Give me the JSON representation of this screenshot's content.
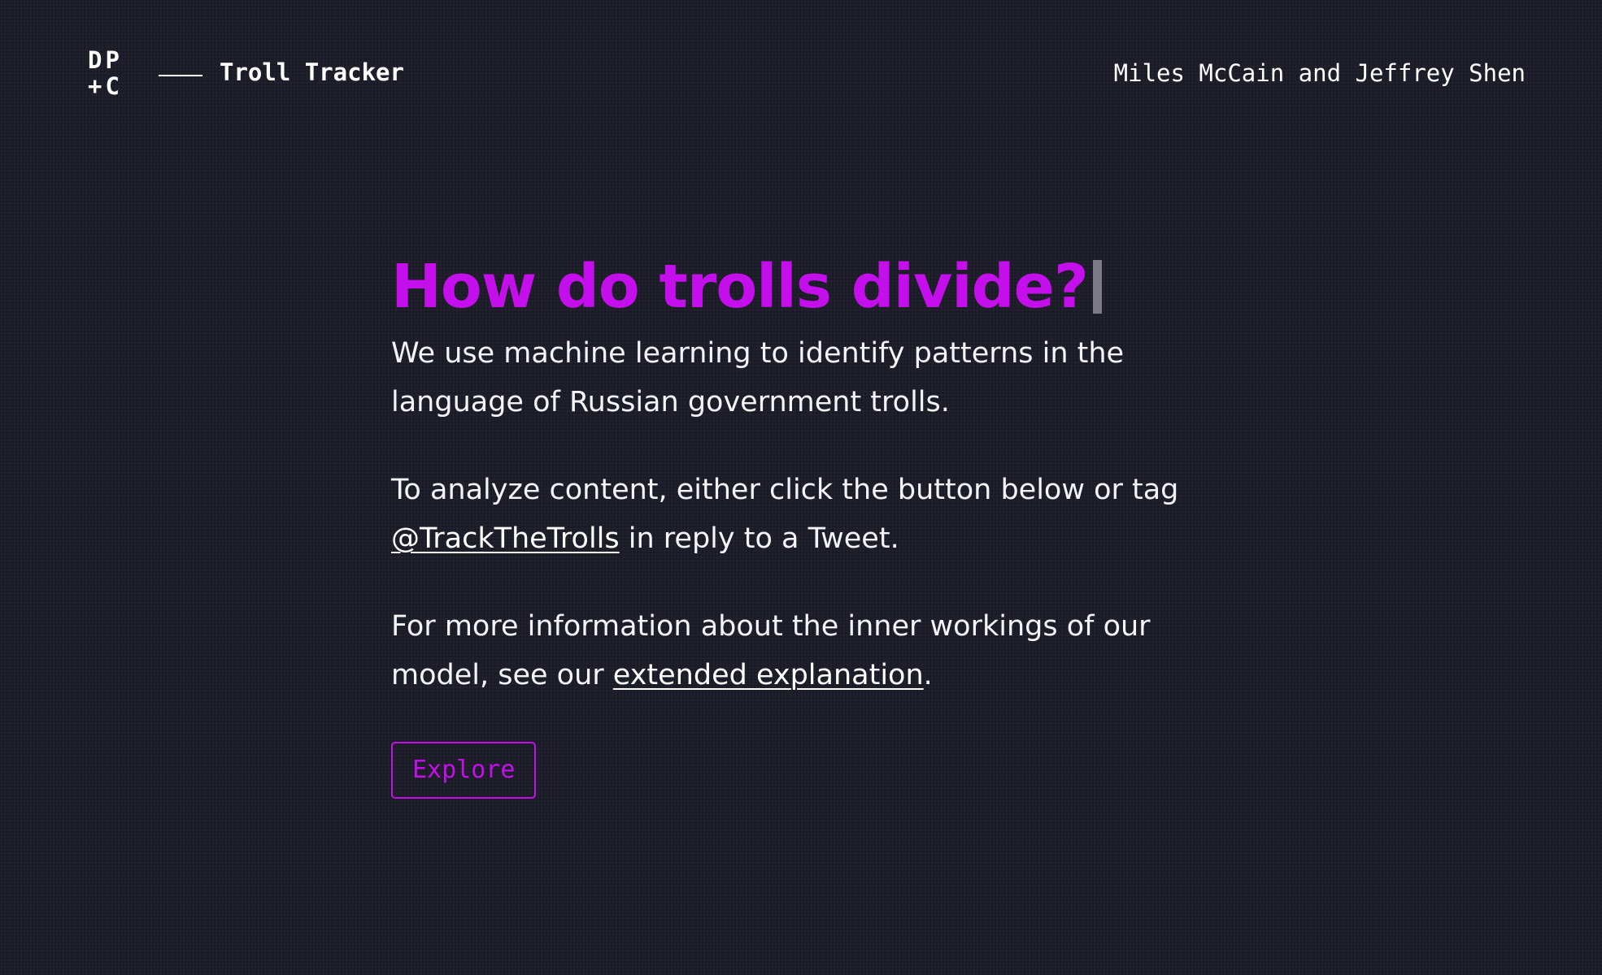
{
  "header": {
    "logo": {
      "line1": "DP",
      "line2": "+C"
    },
    "title": "Troll Tracker",
    "authors": "Miles McCain and Jeffrey Shen"
  },
  "main": {
    "headline": "How do trolls divide?",
    "paragraph1": "We use machine learning to identify patterns in the language of Russian government trolls.",
    "paragraph2": {
      "before": "To analyze content, either click the button below or tag ",
      "link": "@TrackTheTrolls",
      "after": " in reply to a Tweet."
    },
    "paragraph3": {
      "before": "For more information about the inner workings of our model, see our ",
      "link": "extended explanation",
      "after": "."
    },
    "button_label": "Explore"
  },
  "colors": {
    "accent": "#c40eeb",
    "background": "#1d1c29",
    "text": "#ffffff",
    "cursor": "#7b7a86"
  }
}
